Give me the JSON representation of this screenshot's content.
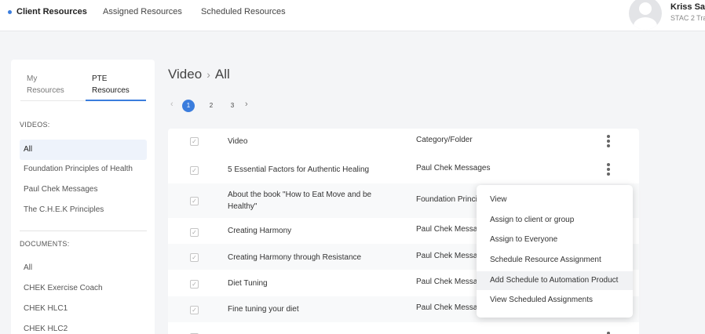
{
  "topnav": {
    "tabs": [
      {
        "label": "Client Resources"
      },
      {
        "label": "Assigned Resources"
      },
      {
        "label": "Scheduled Resources"
      }
    ],
    "user_name": "Kriss San",
    "user_sub": "STAC 2 Tra"
  },
  "sidebar": {
    "tabs": [
      {
        "line1": "My",
        "line2": "Resources"
      },
      {
        "line1": "PTE",
        "line2": "Resources"
      }
    ],
    "videos_heading": "VIDEOS:",
    "videos": [
      "All",
      "Foundation Principles of Health",
      "Paul Chek Messages",
      "The C.H.E.K Principles"
    ],
    "documents_heading": "DOCUMENTS:",
    "documents": [
      "All",
      "CHEK Exercise Coach",
      "CHEK HLC1",
      "CHEK HLC2"
    ]
  },
  "breadcrumb": {
    "root": "Video",
    "separator": "›",
    "current": "All"
  },
  "pagination": {
    "prev": "‹",
    "next": "›",
    "pages": [
      "1",
      "2",
      "3"
    ],
    "current": "1"
  },
  "table": {
    "headers": {
      "title": "Video",
      "category": "Category/Folder"
    },
    "rows": [
      {
        "title": "5 Essential Factors for Authentic Healing",
        "category": "Paul Chek Messages"
      },
      {
        "title": "About the book \"How to Eat Move and be Healthy\"",
        "category": "Foundation Princi"
      },
      {
        "title": "Creating Harmony",
        "category": "Paul Chek Messa"
      },
      {
        "title": "Creating Harmony through Resistance",
        "category": "Paul Chek Messa"
      },
      {
        "title": "Diet Tuning",
        "category": "Paul Chek Messa"
      },
      {
        "title": "Fine tuning your diet",
        "category": "Paul Chek Messa"
      }
    ]
  },
  "menu": {
    "items": [
      "View",
      "Assign to client or group",
      "Assign to Everyone",
      "Schedule Resource Assignment",
      "Add Schedule to Automation Product",
      "View Scheduled Assignments"
    ],
    "highlighted": "Add Schedule to Automation Product"
  },
  "colors": {
    "accent": "#3b7ddd",
    "background": "#f4f5f7",
    "active_item_bg": "#eef3fb"
  }
}
